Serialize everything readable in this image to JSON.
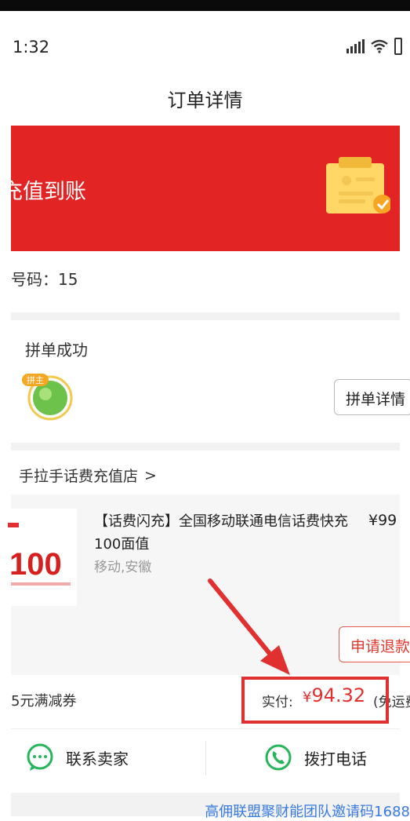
{
  "status_bar": {
    "time": "1:32"
  },
  "nav": {
    "title": "订单详情"
  },
  "banner": {
    "text": "充值到账",
    "color": "#e32424"
  },
  "order": {
    "phone_label": "号码：15"
  },
  "group_buy": {
    "title": "拼单成功",
    "badge": "拼主",
    "detail_button": "拼单详情"
  },
  "store": {
    "name": "手拉手话费充值店",
    "chevron": ">"
  },
  "product": {
    "thumb_text": "100",
    "title": "【话费闪充】全国移动联通电信话费快充100面值",
    "price": "¥99",
    "spec": "移动,安徽",
    "refund_button": "申请退款"
  },
  "payment": {
    "coupon": "5元满减券",
    "paid_label": "实付:",
    "currency": "¥",
    "amount": "94.32",
    "note": "(免运费)",
    "accent_color": "#e03030"
  },
  "actions": {
    "contact_seller": "联系卖家",
    "call": "拨打电话"
  },
  "watermark": "高佣联盟聚财能团队邀请码1688"
}
